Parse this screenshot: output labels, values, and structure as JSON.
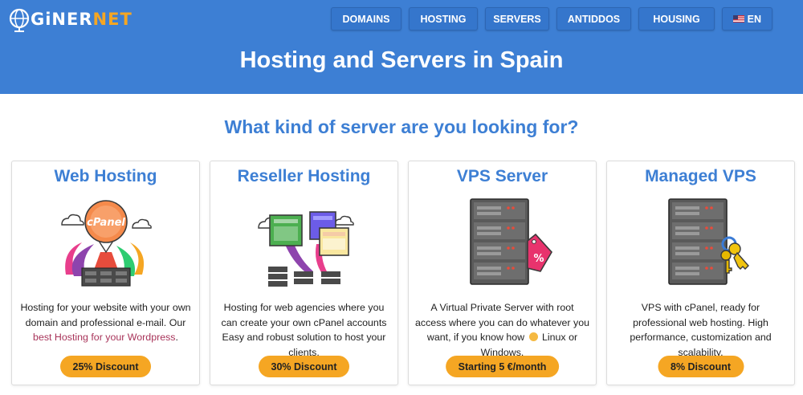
{
  "brand": {
    "logo_prefix": "GiNER",
    "logo_suffix": "NET"
  },
  "nav": [
    {
      "label": "DOMAINS"
    },
    {
      "label": "HOSTING"
    },
    {
      "label": "SERVERS"
    },
    {
      "label": "ANTIDDOS"
    },
    {
      "label": "HOUSING"
    },
    {
      "label": "EN"
    }
  ],
  "page_title": "Hosting and Servers in Spain",
  "subtitle": "What kind of server are you looking for?",
  "cards": [
    {
      "title": "Web Hosting",
      "illus_text": "cPanel",
      "text_1": "Hosting for your website with your own domain and professional e-mail. Our ",
      "link": "best Hosting for your Wordpress",
      "text_2": ".",
      "button": "25% Discount"
    },
    {
      "title": "Reseller Hosting",
      "text": "Hosting for web agencies where you can create your own cPanel accounts Easy and robust solution to host your clients.",
      "button": "30% Discount"
    },
    {
      "title": "VPS Server",
      "illus_text": "%",
      "text_1": "A Virtual Private Server with root access where you can do whatever you want, if you know how ",
      "text_2": " Linux or Windows.",
      "button": "Starting 5 €/month"
    },
    {
      "title": "Managed VPS",
      "text": "VPS with cPanel, ready for professional web hosting. High performance, customization and scalability.",
      "button": "8% Discount"
    }
  ],
  "colors": {
    "header_blue": "#3d7fd4",
    "accent_orange": "#f5a623",
    "link": "#a8345a"
  }
}
